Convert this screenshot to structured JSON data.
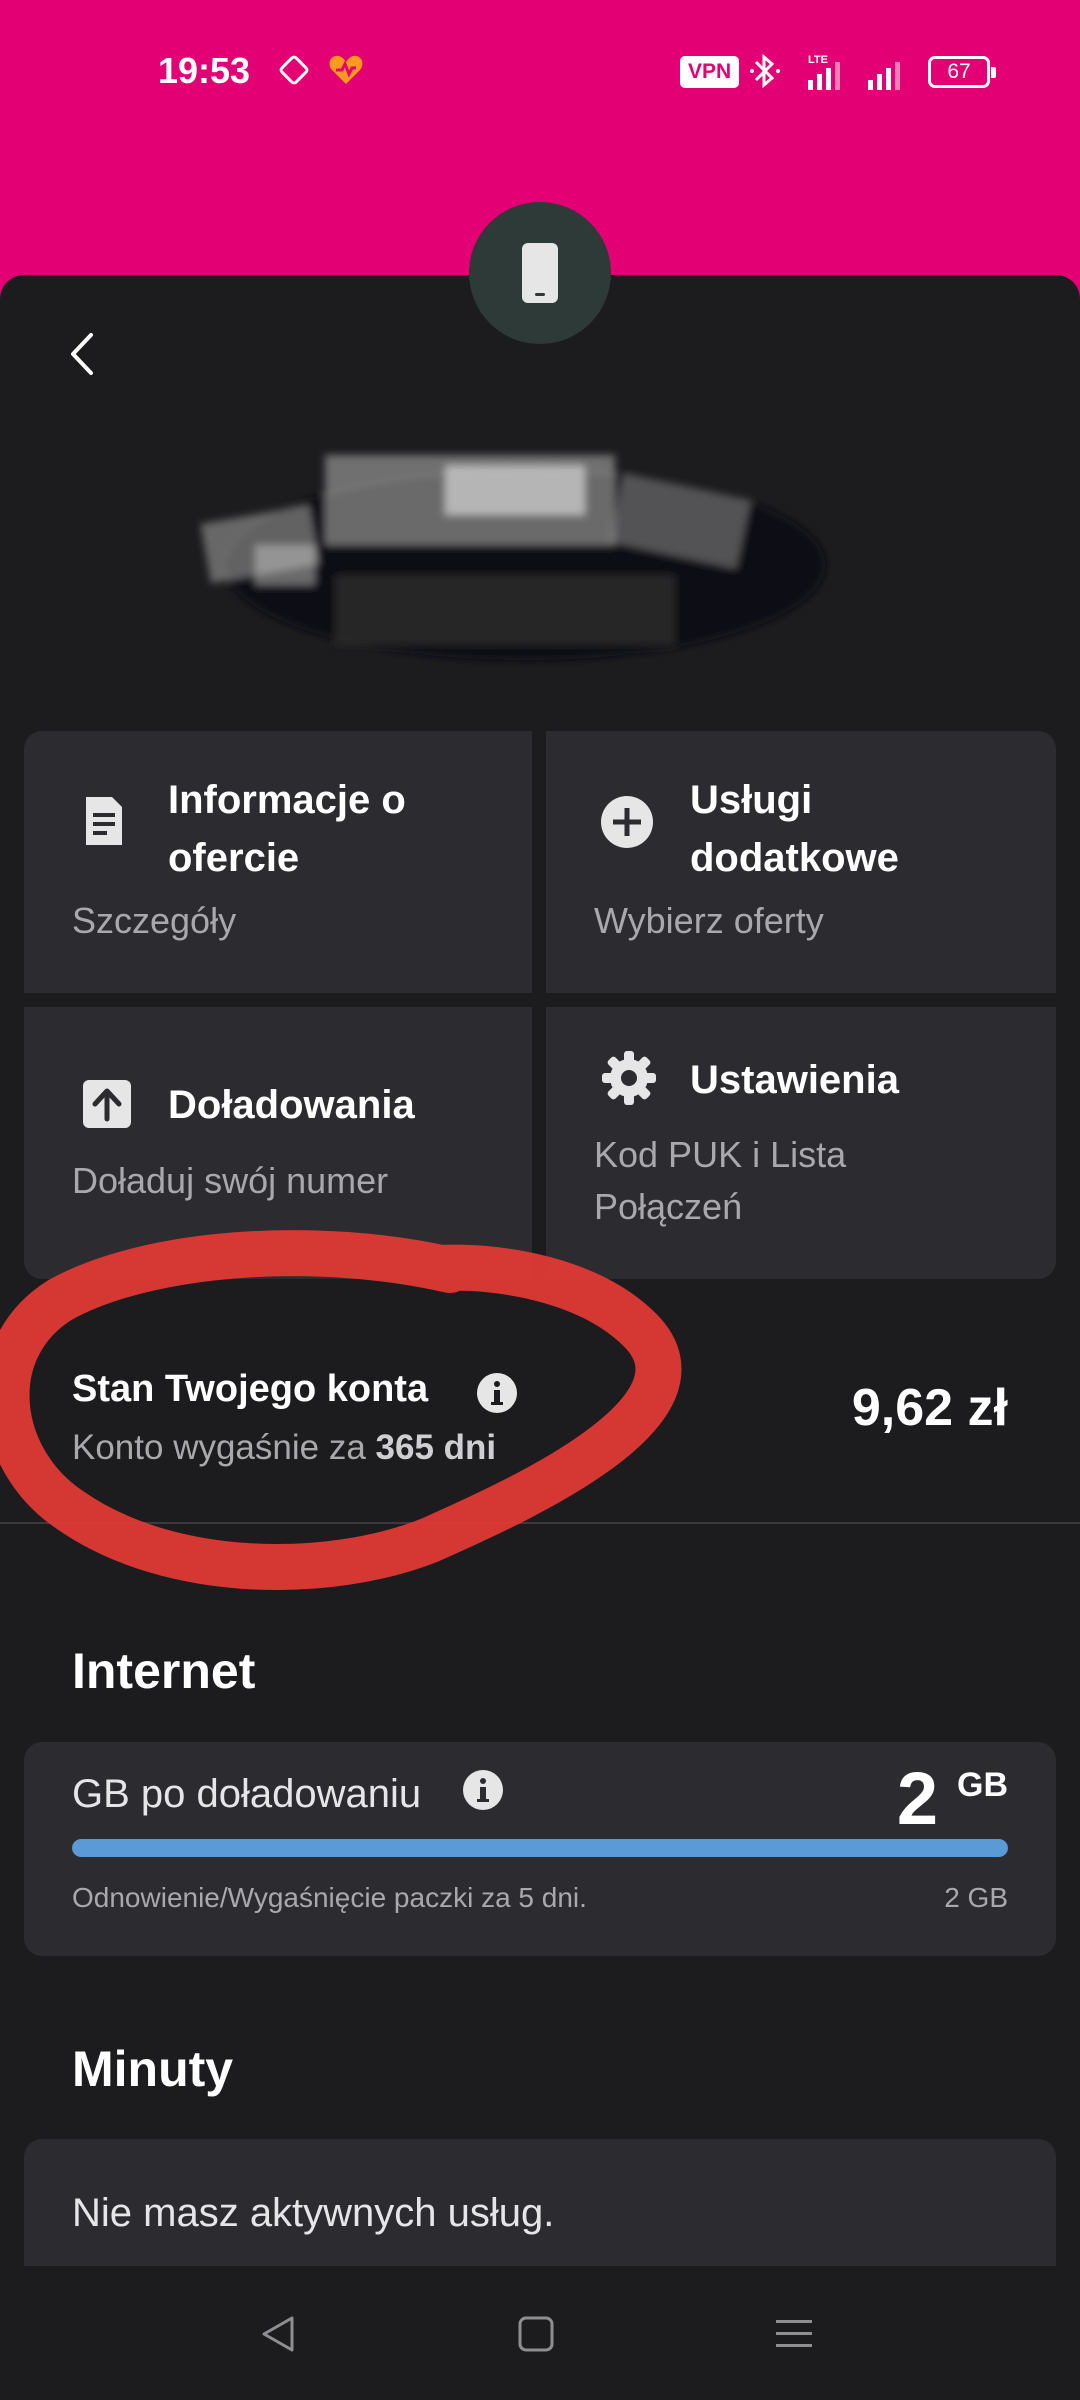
{
  "status_bar": {
    "time": "19:53",
    "vpn_label": "VPN",
    "network_label": "LTE",
    "battery_level": "67"
  },
  "header": {
    "phone_icon": "phone-icon",
    "back_icon": "chevron-left-icon",
    "brand_color": "#e20074"
  },
  "tiles": [
    {
      "title": "Informacje o ofercie",
      "subtitle": "Szczegóły",
      "icon": "document-icon"
    },
    {
      "title": "Usługi dodatkowe",
      "subtitle": "Wybierz oferty",
      "icon": "plus-circle-icon"
    },
    {
      "title": "Doładowania",
      "subtitle": "Doładuj swój numer",
      "icon": "upload-arrow-icon"
    },
    {
      "title": "Ustawienia",
      "subtitle": "Kod PUK i Lista Połączeń",
      "icon": "gear-icon"
    }
  ],
  "balance": {
    "title": "Stan Twojego konta",
    "subtitle_prefix": "Konto wygaśnie za ",
    "subtitle_value": "365 dni",
    "amount": "9,62 zł"
  },
  "internet": {
    "section_title": "Internet",
    "label": "GB po doładowaniu",
    "value": "2",
    "unit": "GB",
    "remaining_fraction": 1.0,
    "renewal_text": "Odnowienie/Wygaśnięcie paczki za 5 dni.",
    "total": "2 GB"
  },
  "minutes": {
    "section_title": "Minuty",
    "empty_text": "Nie masz aktywnych usług."
  },
  "navbar": {
    "back": "nav-back-icon",
    "home": "nav-home-icon",
    "menu": "nav-menu-icon"
  }
}
